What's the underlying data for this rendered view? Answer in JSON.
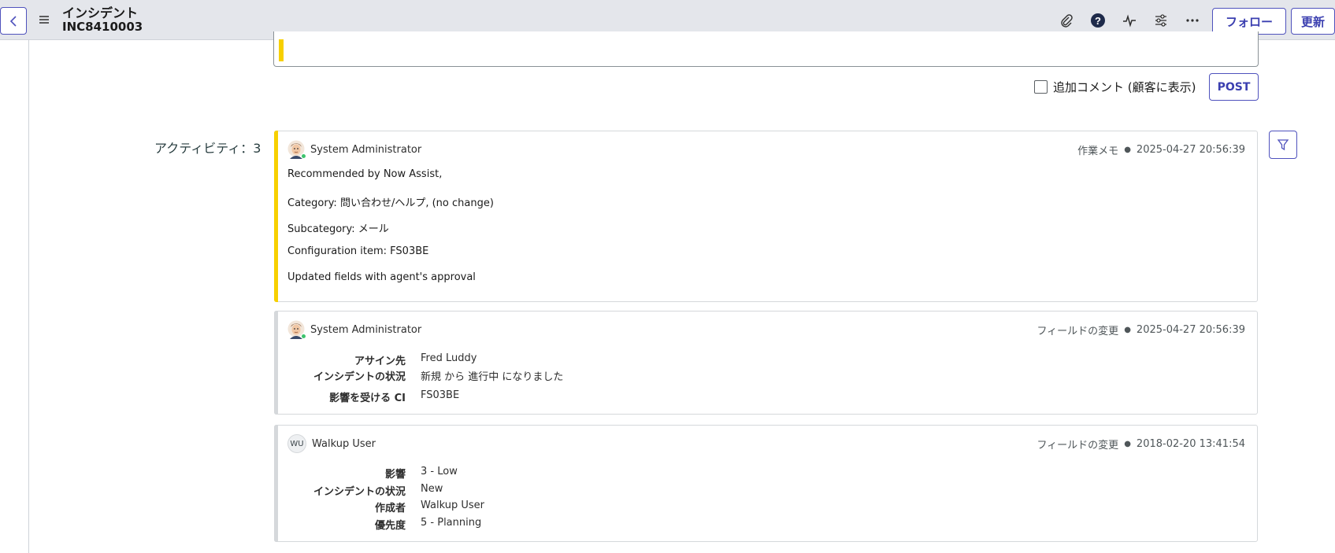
{
  "header": {
    "title": "インシデント",
    "number": "INC8410003",
    "follow_label": "フォロー",
    "update_label": "更新"
  },
  "comment": {
    "checkbox_label": "追加コメント (顧客に表示)",
    "post_label": "POST"
  },
  "activity": {
    "label": "アクティビティ：3",
    "entries": [
      {
        "author": "System Administrator",
        "type": "作業メモ",
        "timestamp": "2025-04-27 20:56:39",
        "lines": [
          "Recommended by Now Assist,",
          "Category: 問い合わせ/ヘルプ, (no change)",
          "Subcategory: メール",
          "Configuration item: FS03BE",
          "Updated fields with agent's approval"
        ]
      },
      {
        "author": "System Administrator",
        "type": "フィールドの変更",
        "timestamp": "2025-04-27 20:56:39",
        "fields": [
          {
            "label": "アサイン先",
            "value": "Fred Luddy"
          },
          {
            "label": "インシデントの状況",
            "value": "新規 から 進行中 になりました"
          },
          {
            "label": "影響を受ける CI",
            "value": "FS03BE"
          }
        ]
      },
      {
        "author": "Walkup User",
        "initials": "WU",
        "type": "フィールドの変更",
        "timestamp": "2018-02-20 13:41:54",
        "fields": [
          {
            "label": "影響",
            "value": "3 - Low"
          },
          {
            "label": "インシデントの状況",
            "value": "New"
          },
          {
            "label": "作成者",
            "value": "Walkup User"
          },
          {
            "label": "優先度",
            "value": "5 - Planning"
          }
        ]
      }
    ]
  },
  "colors": {
    "accent": "#4f52bd",
    "work_note_bar": "#f7d000",
    "field_change_bar": "#d5d8db",
    "online": "#3ec46d"
  }
}
